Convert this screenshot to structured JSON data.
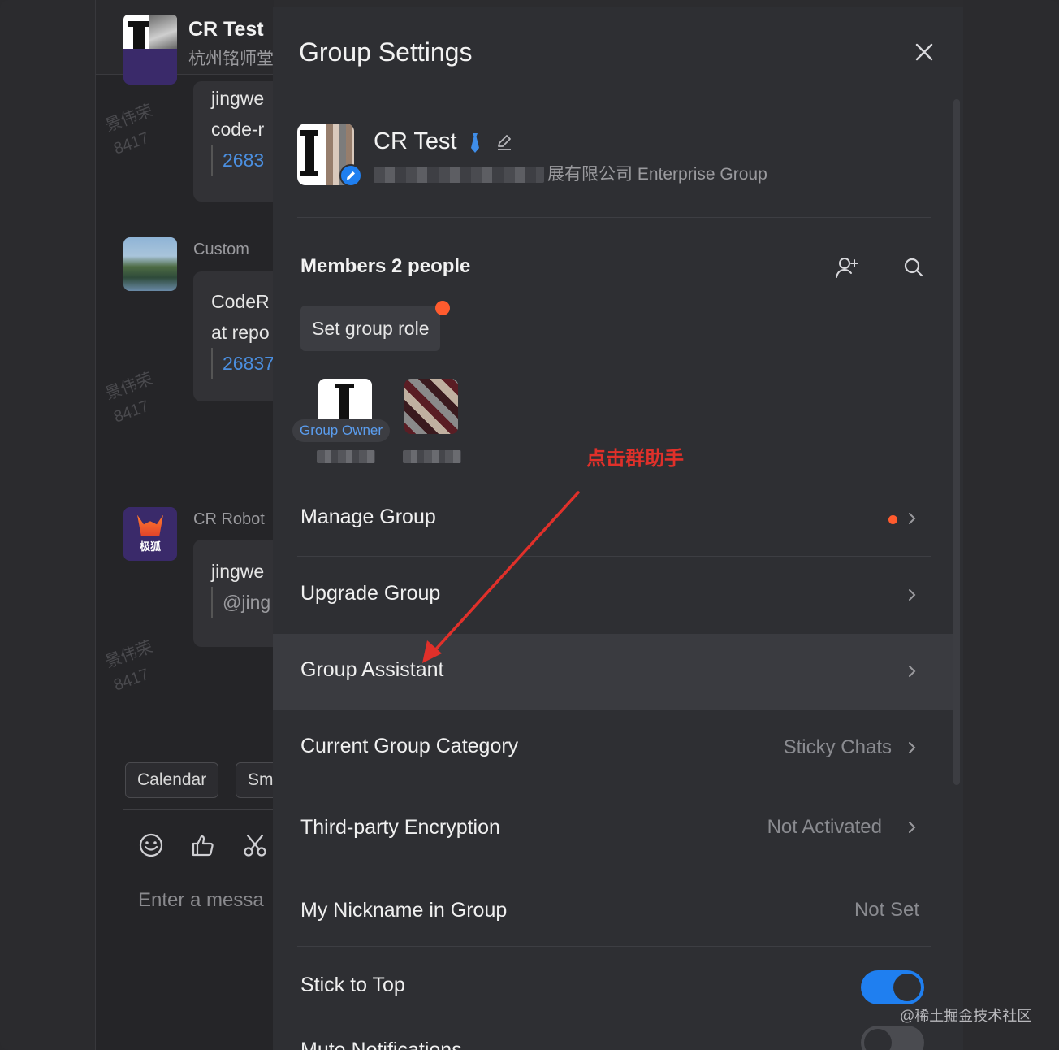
{
  "chat": {
    "title": "CR Test",
    "subtitle": "杭州铭师堂",
    "watermark_name": "景伟荣",
    "watermark_id": "8417",
    "messages": [
      {
        "lines": [
          "jingwe",
          "code-r"
        ],
        "link": "2683"
      },
      {
        "sender": "Custom",
        "lines": [
          "CodeR",
          "at repo"
        ],
        "link": "26837"
      },
      {
        "sender": "CR Robot",
        "lines": [
          "jingwe"
        ],
        "muted": "@jing"
      }
    ],
    "fox_label": "极狐",
    "chips": [
      "Calendar",
      "Sm"
    ],
    "input_placeholder": "Enter a messa"
  },
  "settings": {
    "title": "Group Settings",
    "group": {
      "name": "CR Test",
      "company_suffix": "展有限公司",
      "type": "Enterprise Group"
    },
    "members": {
      "title": "Members 2 people",
      "set_role_label": "Set group role",
      "owner_tag": "Group Owner"
    },
    "annotation": "点击群助手",
    "rows": [
      {
        "label": "Manage Group",
        "value": "",
        "has_dot": true
      },
      {
        "label": "Upgrade Group",
        "value": ""
      },
      {
        "label": "Group Assistant",
        "value": ""
      },
      {
        "label": "Current Group Category",
        "value": "Sticky Chats"
      },
      {
        "label": "Third-party Encryption",
        "value": "Not Activated"
      },
      {
        "label": "My Nickname in Group",
        "value": "Not Set"
      },
      {
        "label": "Stick to Top",
        "toggle": "on"
      },
      {
        "label": "Mute Notifications",
        "toggle": "off"
      }
    ]
  },
  "site_mark": "@稀土掘金技术社区",
  "colors": {
    "accent": "#1f7ff0",
    "badge": "#ff5b2e",
    "annotation": "#e0302a",
    "panel_bg": "#2e2f33"
  }
}
